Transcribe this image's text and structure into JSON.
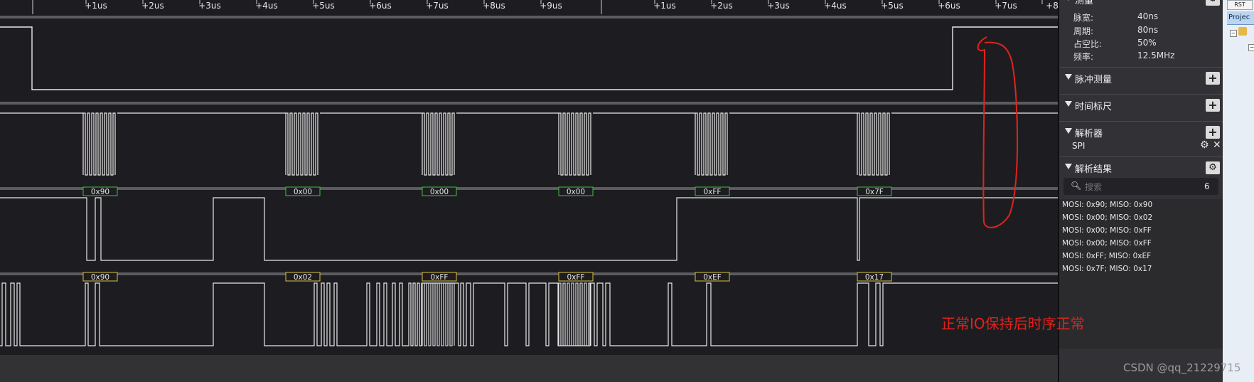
{
  "time_ruler": {
    "ticks_left": [
      "+1us",
      "+2us",
      "+3us",
      "+4us",
      "+5us",
      "+6us",
      "+7us",
      "+8us",
      "+9us"
    ],
    "ticks_right": [
      "+1us",
      "+2us",
      "+3us",
      "+4us",
      "+5us",
      "+6us",
      "+7us",
      "+8"
    ]
  },
  "decode": {
    "mosi": [
      "0x90",
      "0x00",
      "0x00",
      "0x00",
      "0xFF",
      "0x7F"
    ],
    "miso": [
      "0x90",
      "0x02",
      "0xFF",
      "0xFF",
      "0xEF",
      "0x17"
    ]
  },
  "measure": {
    "header": "测量",
    "rows": [
      {
        "label": "脉宽:",
        "value": "40ns"
      },
      {
        "label": "周期:",
        "value": "80ns"
      },
      {
        "label": "占空比:",
        "value": "50%"
      },
      {
        "label": "频率:",
        "value": "12.5MHz"
      }
    ]
  },
  "sections": {
    "pulse": "脉冲测量",
    "timeruler": "时间标尺",
    "analyzer": "解析器",
    "analyzer_item": "SPI",
    "results": "解析结果"
  },
  "search": {
    "placeholder": "搜索",
    "count": "6"
  },
  "results": [
    "MOSI: 0x90;  MISO: 0x90",
    "MOSI: 0x00;  MISO: 0x02",
    "MOSI: 0x00;  MISO: 0xFF",
    "MOSI: 0x00;  MISO: 0xFF",
    "MOSI: 0xFF;  MISO: 0xEF",
    "MOSI: 0x7F;  MISO: 0x17"
  ],
  "ide": {
    "rst": "RST",
    "project_tab": "Projec"
  },
  "annotation": "正常IO保持后时序正常",
  "watermark": "CSDN @qq_21229715",
  "colors": {
    "annotation": "#e0231c",
    "mosi_box": "#3fbf3f",
    "miso_box": "#d8c23a",
    "wave": "#e8e8e8"
  }
}
